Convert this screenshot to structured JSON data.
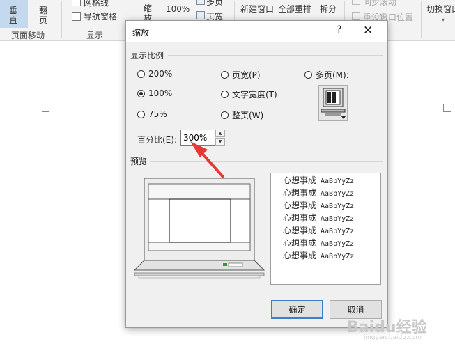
{
  "ribbon": {
    "vertical_btn": [
      "垂",
      "直"
    ],
    "flip_btn": [
      "翻",
      "页"
    ],
    "page_move_group": "页面移动",
    "gridlines": "网格线",
    "nav_pane": "导航窗格",
    "show_group": "显示",
    "zoom_btn": [
      "缩",
      "放"
    ],
    "zoom_100": "100%",
    "multi_page": "多页",
    "page_width": "页宽",
    "new_window": "新建窗口",
    "arrange_all": "全部重排",
    "split": "拆分",
    "sync_scroll": "同步滚动",
    "reset_window": "重设窗口位置",
    "switch_window": "切换窗口"
  },
  "dialog": {
    "title": "缩放",
    "help": "?",
    "close": "✕",
    "zoom_to_label": "显示比例",
    "options": {
      "p200": "200%",
      "p100": "100%",
      "p75": "75%",
      "page_width": "页宽(P)",
      "text_width": "文字宽度(T)",
      "whole_page": "整页(W)",
      "many_pages": "多页(M):"
    },
    "selected": "100%",
    "percent_label": "百分比(E):",
    "percent_value": "300%",
    "preview_label": "预览",
    "preview_lines": [
      "心想事成",
      "心想事成",
      "心想事成",
      "心想事成",
      "心想事成",
      "心想事成",
      "心想事成"
    ],
    "preview_latin": "AaBbYyZz",
    "ok": "确定",
    "cancel": "取消"
  },
  "annotation": {
    "arrow_color": "#e53935"
  },
  "watermark": {
    "brand": "Baidu经验",
    "sub": "jingyan.baidu.com"
  }
}
